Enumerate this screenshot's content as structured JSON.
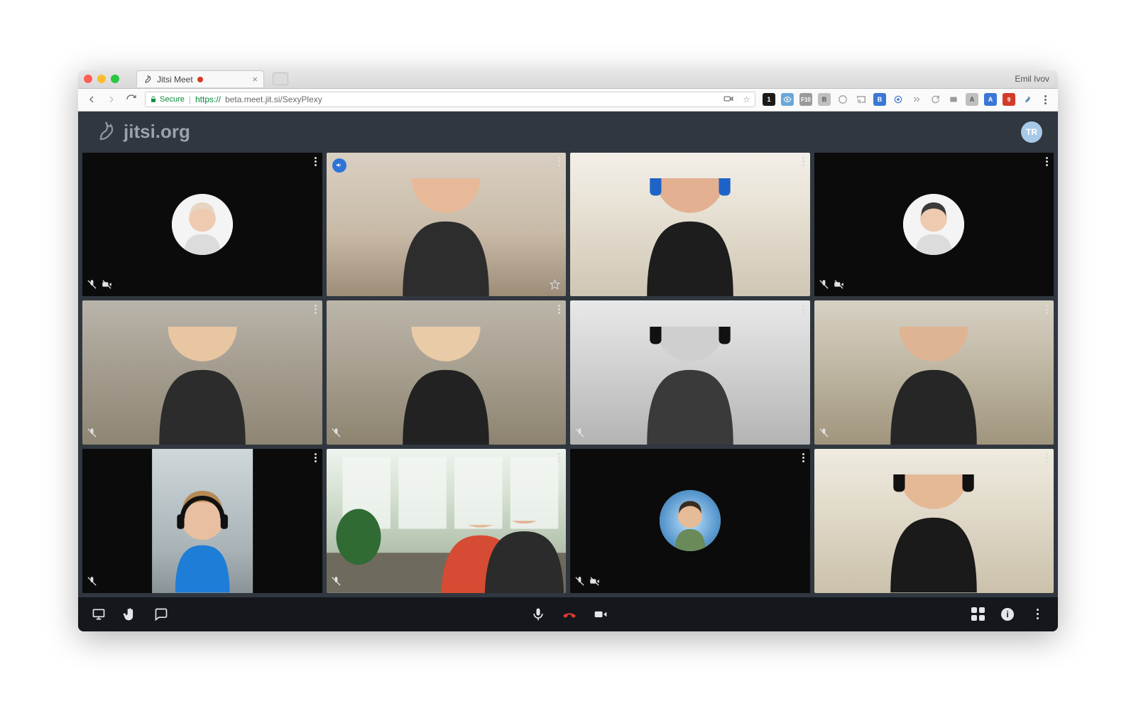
{
  "browser": {
    "tab_title": "Jitsi Meet",
    "profile_name": "Emil Ivov",
    "secure_label": "Secure",
    "url_protocol": "https://",
    "url_rest": "beta.meet.jit.si/SexyPlexy",
    "extension_badge": "1",
    "ext_labels": {
      "f10": "F10",
      "b1": "B",
      "b2": "B",
      "a1": "A",
      "a2": "A",
      "nine": "9"
    }
  },
  "app": {
    "logo_text": "jitsi.org",
    "avatar_initials": "TR"
  },
  "toolbar": {
    "share_screen": "Share screen",
    "raise_hand": "Raise hand",
    "chat": "Chat",
    "mic": "Toggle microphone",
    "hangup": "Leave call",
    "camera": "Toggle camera",
    "tileview": "Tile view",
    "info": "Meeting info",
    "more": "More actions"
  },
  "tiles": [
    {
      "id": 1,
      "type": "avatar",
      "mic_muted": true,
      "cam_off": true
    },
    {
      "id": 2,
      "type": "video",
      "active_speaker": true,
      "pinned": true,
      "favorite": true,
      "scene": {
        "bg": "linear-gradient(180deg,#d9cfc2 0%,#c9bba8 55%,#9d8d78 100%)",
        "skin": "#e7b998",
        "hair": "#caa26a",
        "shirt": "#2d2d2d"
      }
    },
    {
      "id": 3,
      "type": "video",
      "scene": {
        "bg": "linear-gradient(180deg,#f3efe8 0%,#e7e1d4 40%,#cfc6b4 100%)",
        "skin": "#e3b092",
        "hair": "#a77740",
        "shirt": "#1d1d1d",
        "headphones": "#1e63c8"
      }
    },
    {
      "id": 4,
      "type": "avatar",
      "mic_muted": true,
      "cam_off": true
    },
    {
      "id": 5,
      "type": "video",
      "mic_muted": true,
      "scene": {
        "bg": "linear-gradient(180deg,#b9b4aa 0%,#a59e90 45%,#8e8574 100%)",
        "skin": "#e8c6a2",
        "hair": "#1a1a1a",
        "shirt": "#2c2c2c"
      }
    },
    {
      "id": 6,
      "type": "video",
      "mic_muted": true,
      "scene": {
        "bg": "linear-gradient(180deg,#bcb6aa 0%,#a69e8e 50%,#8d8370 100%)",
        "skin": "#e9cba8",
        "hair": "#2a2a2a",
        "shirt": "#222"
      }
    },
    {
      "id": 7,
      "type": "video",
      "mic_muted": true,
      "grayscale": true,
      "circle_indicator": true,
      "scene": {
        "bg": "linear-gradient(180deg,#e8e8e8 0%,#cfcfcf 50%,#b3b3b3 100%)",
        "skin": "#cfcfcf",
        "hair": "#222",
        "shirt": "#3a3a3a",
        "headphones": "#111"
      }
    },
    {
      "id": 8,
      "type": "video",
      "mic_muted": true,
      "scene": {
        "bg": "linear-gradient(180deg,#d7d1c4 0%,#c0b8a4 45%,#a0957d 100%)",
        "skin": "#dfb493",
        "hair": "#4a3a2c",
        "shirt": "#262626"
      }
    },
    {
      "id": 9,
      "type": "video-narrow",
      "mic_muted": true,
      "scene": {
        "bg": "linear-gradient(180deg,#cfd7da 0%,#a9b3b7 70%,#8a9498 100%)",
        "skin": "#e8bfa0",
        "hair": "#b78a55",
        "shirt": "#1e7dd6",
        "headphones": "#111"
      }
    },
    {
      "id": 10,
      "type": "room",
      "mic_muted": true,
      "scene": {
        "bg": "linear-gradient(180deg,#eef3ee 0%,#d7e2d4 30%,#b8c6b3 65%,#8f9b89 100%)"
      }
    },
    {
      "id": 11,
      "type": "avatar",
      "mic_muted": true,
      "cam_off": true,
      "avatar_variant": "photo"
    },
    {
      "id": 12,
      "type": "video",
      "scene": {
        "bg": "linear-gradient(180deg,#efebe0 0%,#ded7c6 50%,#cbc1ab 100%)",
        "skin": "#e6b996",
        "hair": "#2b2b2b",
        "shirt": "#1a1a1a",
        "headphones": "#111"
      }
    }
  ]
}
